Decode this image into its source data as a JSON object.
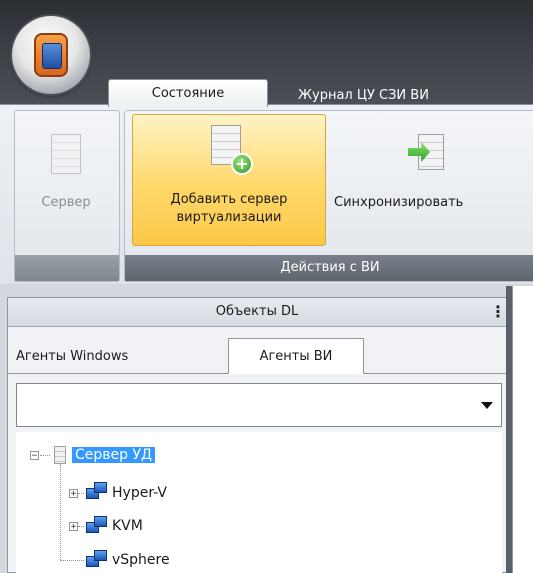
{
  "ribbon": {
    "tabs": [
      {
        "label": "Состояние",
        "active": true
      },
      {
        "label": "Журнал ЦУ СЗИ ВИ",
        "active": false
      }
    ],
    "groups": [
      {
        "label": "",
        "buttons": [
          {
            "label": "Сервер",
            "icon": "server-icon",
            "enabled": false
          }
        ]
      },
      {
        "label": "Действия с ВИ",
        "buttons": [
          {
            "label_line1": "Добавить сервер",
            "label_line2": "виртуализации",
            "icon": "add-server-icon",
            "highlighted": true
          },
          {
            "label": "Синхронизировать",
            "icon": "sync-icon"
          }
        ]
      }
    ]
  },
  "panel": {
    "title": "Объекты DL",
    "tabs": [
      {
        "label": "Агенты Windows",
        "active": false
      },
      {
        "label": "Агенты ВИ",
        "active": true
      }
    ],
    "combo_value": "",
    "tree": {
      "root": {
        "label": "Сервер УД",
        "icon": "server-icon",
        "expanded": true,
        "selected": true
      },
      "children": [
        {
          "label": "Hyper-V",
          "icon": "network-icon",
          "expandable": true
        },
        {
          "label": "KVM",
          "icon": "network-icon",
          "expandable": true
        },
        {
          "label": "vSphere",
          "icon": "network-icon",
          "expandable": false
        }
      ]
    }
  },
  "colors": {
    "highlight": "#ffd86a",
    "selection": "#3399ff",
    "titlebar": "#34383e"
  }
}
